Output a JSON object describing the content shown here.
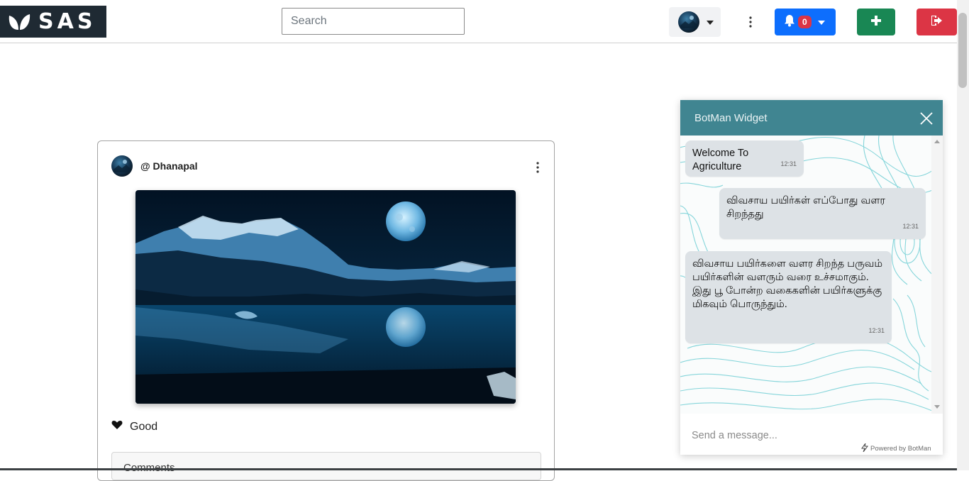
{
  "app": {
    "brand": "SAS"
  },
  "navbar": {
    "search_placeholder": "Search",
    "notifications_count": "0",
    "icons": [
      "leaf-logo-icon",
      "avatar",
      "caret-down-icon",
      "vertical-dots-icon",
      "bell-icon",
      "plus-icon",
      "sign-out-icon"
    ],
    "colors": {
      "logo_bg": "#1f2a33",
      "bell_btn": "#0d6efd",
      "plus_btn": "#198754",
      "exit_btn": "#dc3545",
      "badge": "#dc3545"
    }
  },
  "post": {
    "author": "@ Dhanapal",
    "reaction_label": "Good",
    "comments_title": "Comments",
    "icons": [
      "avatar",
      "vertical-dots-icon",
      "heart-icon"
    ]
  },
  "chat": {
    "title": "BotMan Widget",
    "messages": [
      {
        "text": "Welcome To Agriculture",
        "time": "12:31"
      },
      {
        "text": "விவசாய பயிர்கள் எப்போது வளர சிறந்தது",
        "time": "12:31"
      },
      {
        "text": "விவசாய பயிர்களை வளர சிறந்த பருவம் பயிர்களின் வளரும் வரை உச்சமாகும். இது பூ போன்ற வகைகளின் பயிர்களுக்கு மிகவும் பொருந்தும்.",
        "time": "12:31"
      }
    ],
    "input_placeholder": "Send a message...",
    "powered_by": "Powered by BotMan",
    "colors": {
      "header": "#408591",
      "bubble": "#dde2e6",
      "pattern": "#5fc8cf"
    }
  }
}
